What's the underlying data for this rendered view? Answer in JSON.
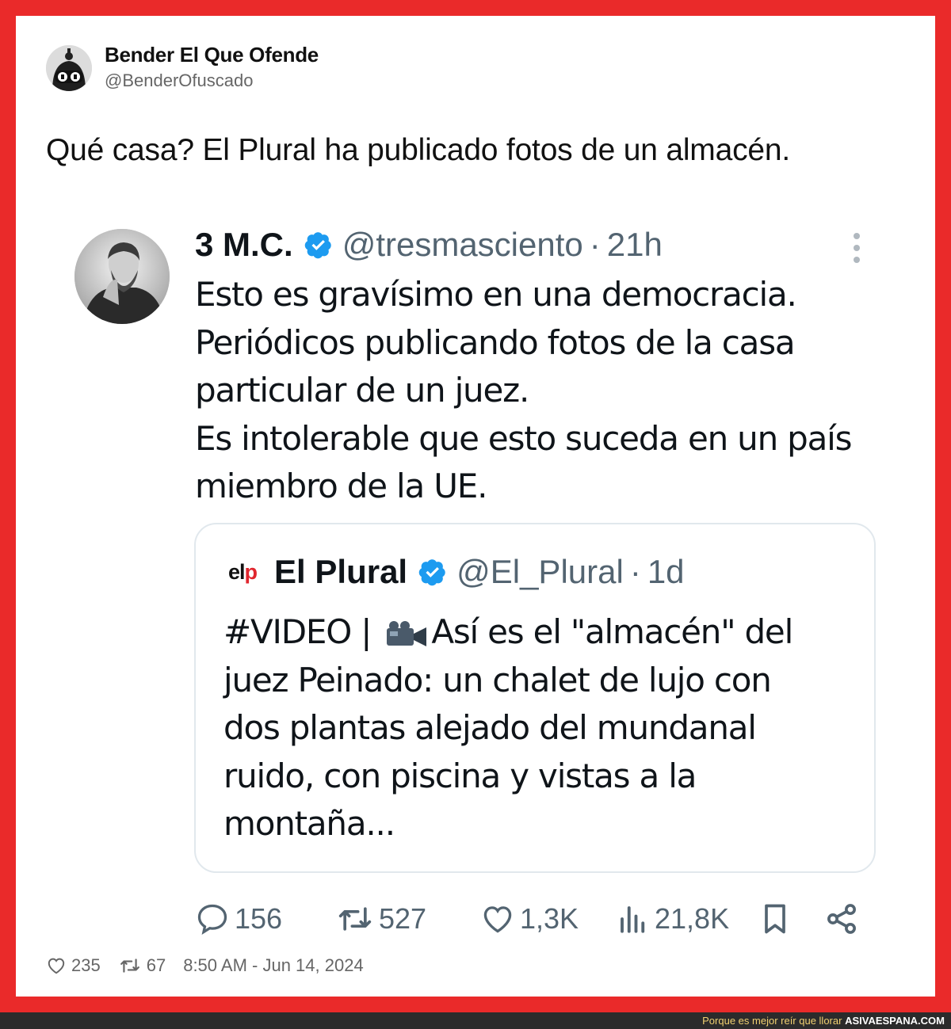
{
  "outer_tweet": {
    "display_name": "Bender El Que Ofende",
    "handle": "@BenderOfuscado",
    "text": "Qué casa? El Plural ha publicado fotos de un almacén.",
    "likes": "235",
    "retweets": "67",
    "timestamp": "8:50 AM - Jun 14, 2024"
  },
  "quoted_tweet": {
    "display_name": "3 M.C.",
    "handle": "@tresmasciento",
    "separator": "·",
    "age": "21h",
    "text_lines": [
      "Esto es gravísimo en una democracia.",
      "Periódicos publicando fotos de la casa",
      "particular de un juez.",
      "Es intolerable que esto suceda en un país",
      "miembro de la UE."
    ],
    "replies": "156",
    "retweets": "527",
    "likes": "1,3K",
    "views": "21,8K"
  },
  "inner_tweet": {
    "logo_el": "el",
    "logo_p": "p",
    "display_name": "El Plural",
    "handle": "@El_Plural",
    "separator": "·",
    "age": "1d",
    "line1_prefix": "#VIDEO | ",
    "line1_suffix": "Así es el \"almacén\" del",
    "text_lines": [
      "juez Peinado: un chalet de lujo con",
      "dos plantas alejado del mundanal",
      "ruido, con piscina y vistas a la",
      "montaña..."
    ]
  },
  "footer": {
    "slogan": "Porque es mejor reír que llorar",
    "site": "ASIVAESPANA.COM"
  },
  "colors": {
    "frame": "#ea2a2a",
    "verified": "#1d9bf0",
    "muted": "#536471",
    "logo_red": "#e0262e"
  },
  "icons": [
    "reply-icon",
    "retweet-icon",
    "like-icon",
    "views-icon",
    "bookmark-icon",
    "share-icon",
    "more-icon",
    "verified-icon",
    "video-camera-icon"
  ]
}
